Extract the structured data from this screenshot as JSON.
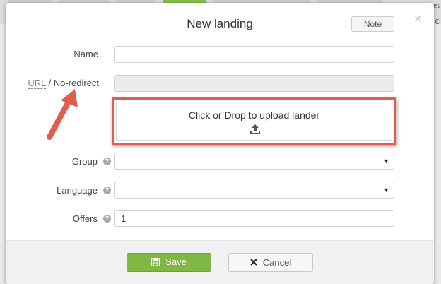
{
  "background": {
    "right_text_top": "os",
    "right_text_mid": "c"
  },
  "modal": {
    "title": "New landing",
    "note_label": "Note",
    "close_glyph": "×"
  },
  "form": {
    "name_label": "Name",
    "name_value": "",
    "url_label": "URL",
    "url_separator": " / ",
    "no_redirect_label": "No-redirect",
    "url_value": "",
    "upload_text": "Click or Drop to upload lander",
    "group_label": "Group",
    "group_value": "",
    "language_label": "Language",
    "language_value": "",
    "offers_label": "Offers",
    "offers_value": "1",
    "help_glyph": "?"
  },
  "footer": {
    "save_label": "Save",
    "cancel_label": "Cancel"
  },
  "colors": {
    "save_green": "#7fb845",
    "highlight_red": "#e35d4f"
  },
  "icons": [
    "save-icon",
    "cancel-x-icon",
    "upload-icon",
    "help-icon",
    "close-icon",
    "annotation-arrow"
  ]
}
